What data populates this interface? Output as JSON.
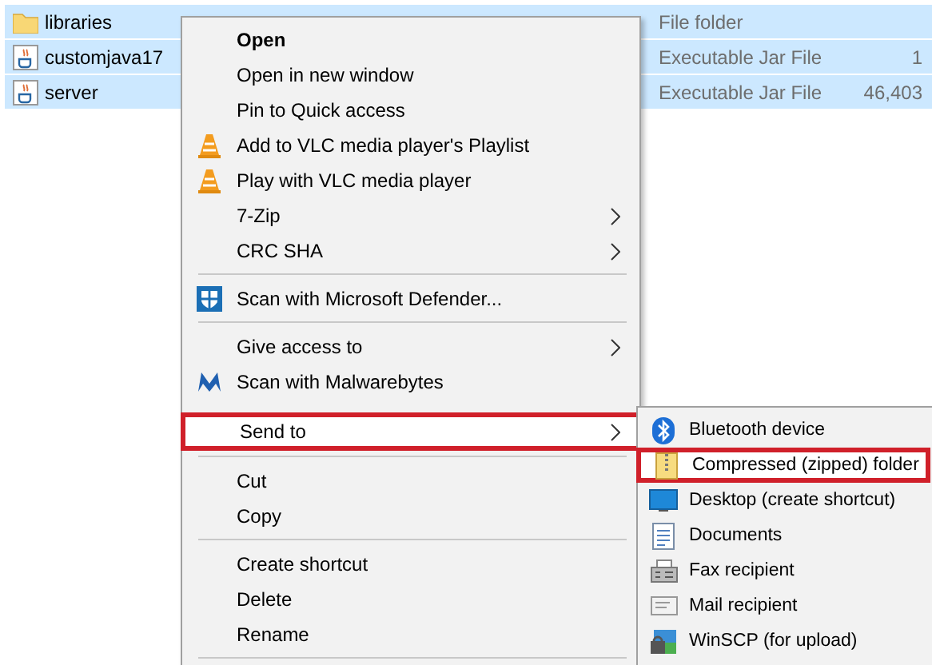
{
  "files": [
    {
      "name": "libraries",
      "type": "File folder",
      "selected": true
    },
    {
      "name": "customjava17",
      "type": "Executable Jar File",
      "size": "1",
      "selected": true
    },
    {
      "name": "server",
      "type": "Executable Jar File",
      "size": "46,403",
      "selected": true
    }
  ],
  "context_menu": {
    "items": [
      {
        "kind": "item",
        "label": "Open",
        "default": true,
        "submenu": false,
        "selected": false
      },
      {
        "kind": "item",
        "label": "Open in new window",
        "default": false,
        "submenu": false,
        "selected": false
      },
      {
        "kind": "item",
        "label": "Pin to Quick access",
        "default": false,
        "submenu": false,
        "selected": false
      },
      {
        "kind": "item",
        "label": "Add to VLC media player's Playlist",
        "default": false,
        "submenu": false,
        "selected": false
      },
      {
        "kind": "item",
        "label": "Play with VLC media player",
        "default": false,
        "submenu": false,
        "selected": false
      },
      {
        "kind": "item",
        "label": "7-Zip",
        "default": false,
        "submenu": true,
        "selected": false
      },
      {
        "kind": "item",
        "label": "CRC SHA",
        "default": false,
        "submenu": true,
        "selected": false
      },
      {
        "kind": "separator"
      },
      {
        "kind": "item",
        "label": "Scan with Microsoft Defender...",
        "default": false,
        "submenu": false,
        "selected": false
      },
      {
        "kind": "separator"
      },
      {
        "kind": "item",
        "label": "Give access to",
        "default": false,
        "submenu": true,
        "selected": false
      },
      {
        "kind": "item",
        "label": "Scan with Malwarebytes",
        "default": false,
        "submenu": false,
        "selected": false
      },
      {
        "kind": "item",
        "label": "Send to",
        "default": false,
        "submenu": true,
        "selected": true
      },
      {
        "kind": "separator"
      },
      {
        "kind": "item",
        "label": "Cut",
        "default": false,
        "submenu": false,
        "selected": false
      },
      {
        "kind": "item",
        "label": "Copy",
        "default": false,
        "submenu": false,
        "selected": false
      },
      {
        "kind": "separator"
      },
      {
        "kind": "item",
        "label": "Create shortcut",
        "default": false,
        "submenu": false,
        "selected": false
      },
      {
        "kind": "item",
        "label": "Delete",
        "default": false,
        "submenu": false,
        "selected": false
      },
      {
        "kind": "item",
        "label": "Rename",
        "default": false,
        "submenu": false,
        "selected": false
      },
      {
        "kind": "separator"
      }
    ]
  },
  "send_to_menu": {
    "items": [
      {
        "label": "Bluetooth device",
        "selected": false
      },
      {
        "label": "Compressed (zipped) folder",
        "selected": true
      },
      {
        "label": "Desktop (create shortcut)",
        "selected": false
      },
      {
        "label": "Documents",
        "selected": false
      },
      {
        "label": "Fax recipient",
        "selected": false
      },
      {
        "label": "Mail recipient",
        "selected": false
      },
      {
        "label": "WinSCP (for upload)",
        "selected": false
      }
    ]
  }
}
